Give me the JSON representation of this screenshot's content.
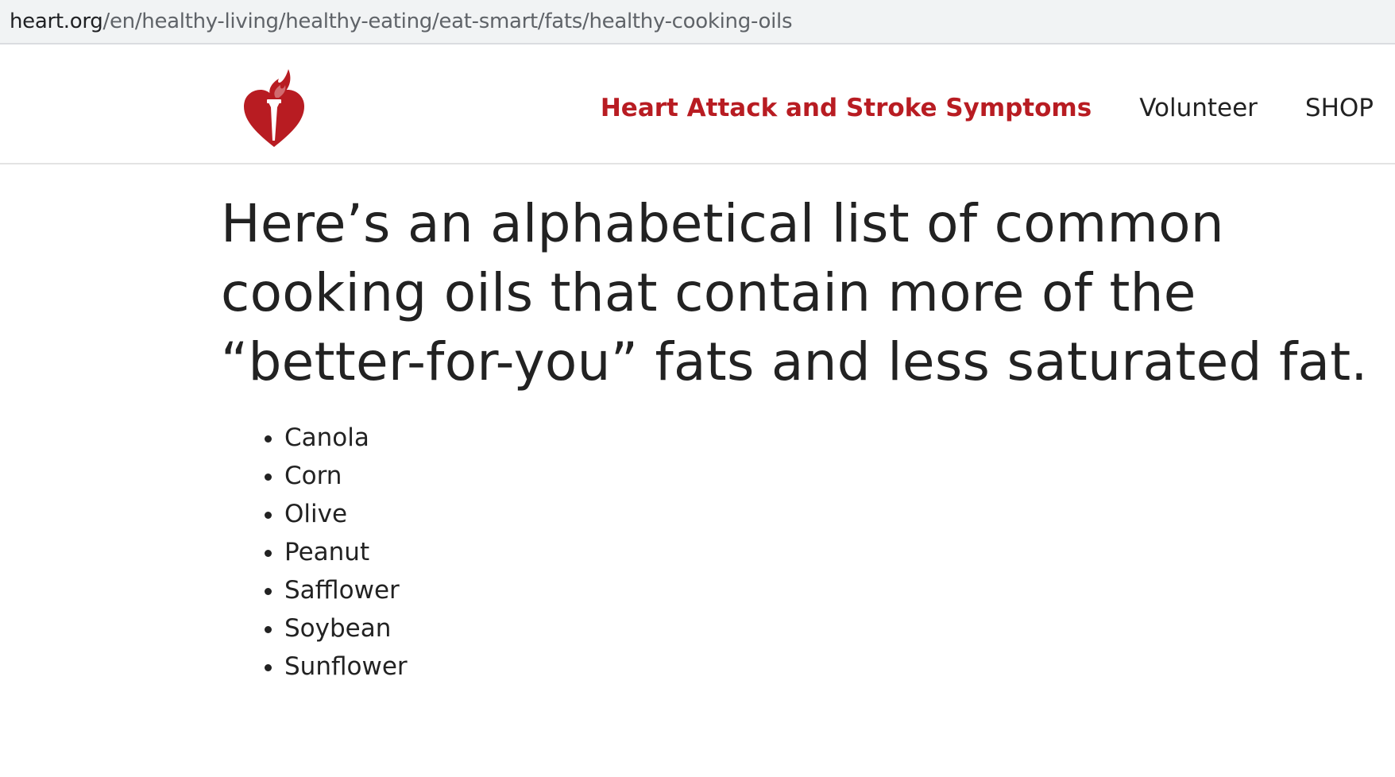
{
  "browser": {
    "url_domain": "heart.org",
    "url_path": "/en/healthy-living/healthy-eating/eat-smart/fats/healthy-cooking-oils"
  },
  "header": {
    "logo_icon": "heart-torch-logo-icon",
    "nav": [
      {
        "label": "Heart Attack and Stroke Symptoms",
        "color": "#b81c22"
      },
      {
        "label": "Volunteer"
      },
      {
        "label": "SHOP"
      }
    ]
  },
  "main": {
    "headline": "Here’s an alphabetical list of common cooking oils that contain more of the “better-for-you” fats and less saturated fat.",
    "oils": [
      "Canola",
      "Corn",
      "Olive",
      "Peanut",
      "Safflower",
      "Soybean",
      "Sunflower"
    ]
  },
  "colors": {
    "brand_red": "#b81c22",
    "text": "#222222",
    "url_bar_bg": "#f1f3f4"
  }
}
